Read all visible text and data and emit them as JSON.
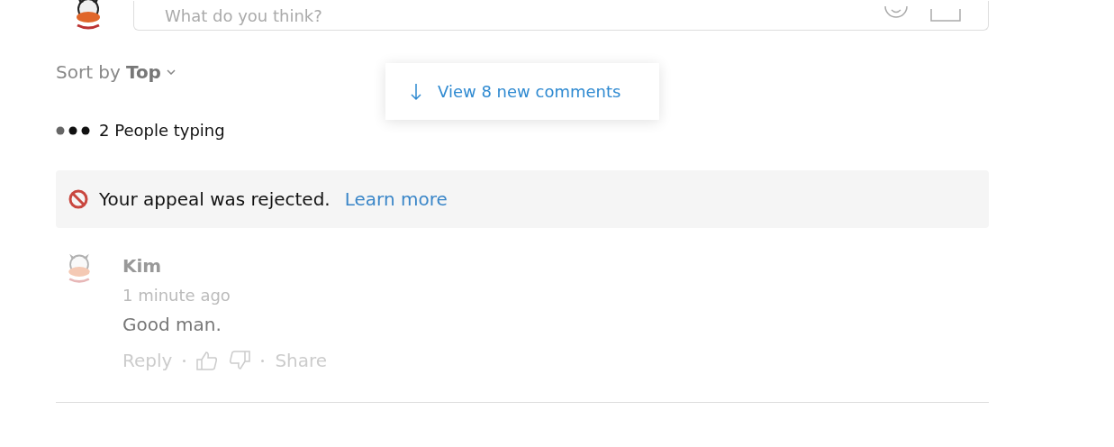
{
  "composer": {
    "placeholder": "What do you think?"
  },
  "sort": {
    "label": "Sort by",
    "value": "Top"
  },
  "new_comments": {
    "label": "View 8 new comments"
  },
  "typing": {
    "label": "2 People typing"
  },
  "notice": {
    "message": "Your appeal was rejected.",
    "link": "Learn more"
  },
  "comments": [
    {
      "author": "Kim",
      "time": "1 minute ago",
      "text": "Good man.",
      "actions": {
        "reply": "Reply",
        "share": "Share"
      }
    }
  ]
}
